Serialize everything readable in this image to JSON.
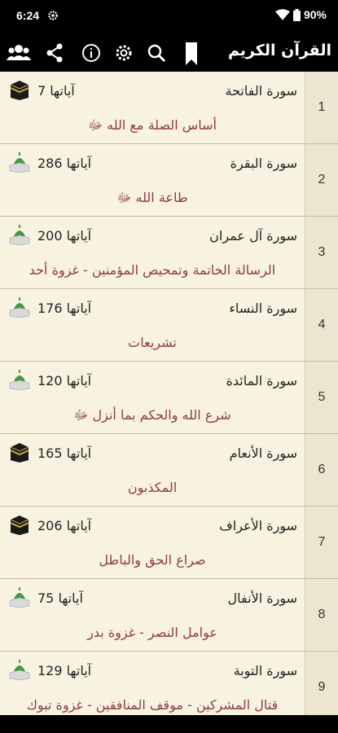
{
  "status": {
    "time": "6:24",
    "battery": "90%",
    "icons": [
      "settings-small-icon",
      "wifi-icon",
      "battery-icon"
    ]
  },
  "appbar": {
    "title": "القرآن الكريم",
    "icons": [
      "users-icon",
      "share-icon",
      "info-icon",
      "settings-icon",
      "search-icon",
      "bookmark-icon"
    ]
  },
  "surahs": [
    {
      "num": "1",
      "name": "سورة الفاتحة",
      "ayat": "آياتها 7",
      "theme": "أساس الصلة مع الله ﷻ",
      "place": "meccan"
    },
    {
      "num": "2",
      "name": "سورة البقرة",
      "ayat": "آياتها 286",
      "theme": "طاعة الله ﷻ",
      "place": "medinan"
    },
    {
      "num": "3",
      "name": "سورة آل عمران",
      "ayat": "آياتها 200",
      "theme": "الرسالة الخاتمة وتمحيص المؤمنين - غزوة أحد",
      "place": "medinan"
    },
    {
      "num": "4",
      "name": "سورة النساء",
      "ayat": "آياتها 176",
      "theme": "تشريعات",
      "place": "medinan"
    },
    {
      "num": "5",
      "name": "سورة المائدة",
      "ayat": "آياتها 120",
      "theme": "شرع الله والحكم بما أنزل ﷻ",
      "place": "medinan"
    },
    {
      "num": "6",
      "name": "سورة الأنعام",
      "ayat": "آياتها 165",
      "theme": "المكذبون",
      "place": "meccan"
    },
    {
      "num": "7",
      "name": "سورة الأعراف",
      "ayat": "آياتها 206",
      "theme": "صراع الحق والباطل",
      "place": "meccan"
    },
    {
      "num": "8",
      "name": "سورة الأنفال",
      "ayat": "آياتها 75",
      "theme": "عوامل النصر - غزوة بدر",
      "place": "medinan"
    },
    {
      "num": "9",
      "name": "سورة التوبة",
      "ayat": "آياتها 129",
      "theme": "قتال المشركين - موقف المنافقين - غزوة تبوك",
      "place": "medinan"
    }
  ],
  "colors": {
    "background": "#f8f3e1",
    "numberColumn": "#ece6d0",
    "theme": "#8e3b3a",
    "bar": "#000000"
  }
}
